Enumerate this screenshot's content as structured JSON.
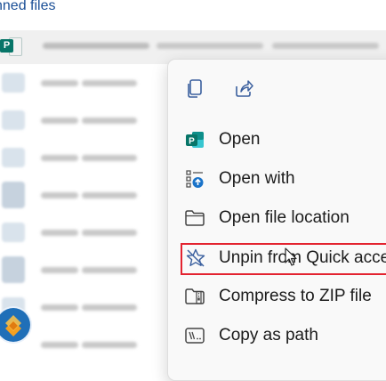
{
  "section": {
    "title": "nned files"
  },
  "context_menu": {
    "top_actions": [
      {
        "icon": "copy-icon"
      },
      {
        "icon": "share-icon"
      }
    ],
    "items": [
      {
        "label": "Open",
        "icon": "publisher-app-icon"
      },
      {
        "label": "Open with",
        "icon": "open-with-icon"
      },
      {
        "label": "Open file location",
        "icon": "folder-icon"
      },
      {
        "label": "Unpin from Quick acce",
        "icon": "unpin-star-icon"
      },
      {
        "label": "Compress to ZIP file",
        "icon": "zip-icon"
      },
      {
        "label": "Copy as path",
        "icon": "copy-path-icon"
      }
    ]
  },
  "colors": {
    "title_blue": "#1b4f96",
    "publisher_teal": "#077568",
    "highlight_red": "#e32330",
    "menu_bg": "#f9f9f9"
  }
}
